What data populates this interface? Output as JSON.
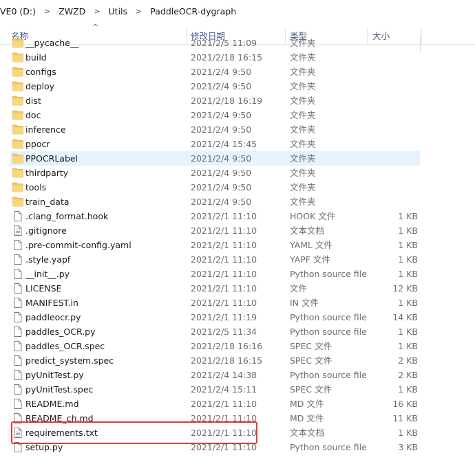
{
  "breadcrumb": [
    "VE0 (D:)",
    "ZWZD",
    "Utils",
    "PaddleOCR-dygraph"
  ],
  "columns": {
    "name": "名称",
    "date": "修改日期",
    "type": "类型",
    "size": "大小"
  },
  "colors": {
    "folder": "#f4c75e",
    "folder_dark": "#e0ac3a",
    "highlight": "#e5f3ff",
    "red_box": "#e33a3a",
    "header_text": "#4a5c86"
  },
  "files": [
    {
      "name": "__pycache__",
      "date": "2021/2/5 11:09",
      "type": "文件夹",
      "size": "",
      "icon": "folder-icon"
    },
    {
      "name": "build",
      "date": "2021/2/18 16:15",
      "type": "文件夹",
      "size": "",
      "icon": "folder-icon"
    },
    {
      "name": "configs",
      "date": "2021/2/4 9:50",
      "type": "文件夹",
      "size": "",
      "icon": "folder-icon"
    },
    {
      "name": "deploy",
      "date": "2021/2/4 9:50",
      "type": "文件夹",
      "size": "",
      "icon": "folder-icon"
    },
    {
      "name": "dist",
      "date": "2021/2/18 16:19",
      "type": "文件夹",
      "size": "",
      "icon": "folder-icon"
    },
    {
      "name": "doc",
      "date": "2021/2/4 9:50",
      "type": "文件夹",
      "size": "",
      "icon": "folder-icon"
    },
    {
      "name": "inference",
      "date": "2021/2/4 9:50",
      "type": "文件夹",
      "size": "",
      "icon": "folder-icon"
    },
    {
      "name": "ppocr",
      "date": "2021/2/4 15:45",
      "type": "文件夹",
      "size": "",
      "icon": "folder-icon"
    },
    {
      "name": "PPOCRLabel",
      "date": "2021/2/4 9:50",
      "type": "文件夹",
      "size": "",
      "icon": "folder-icon",
      "highlight": true
    },
    {
      "name": "thirdparty",
      "date": "2021/2/4 9:50",
      "type": "文件夹",
      "size": "",
      "icon": "folder-icon"
    },
    {
      "name": "tools",
      "date": "2021/2/4 9:50",
      "type": "文件夹",
      "size": "",
      "icon": "folder-icon"
    },
    {
      "name": "train_data",
      "date": "2021/2/4 9:50",
      "type": "文件夹",
      "size": "",
      "icon": "folder-icon"
    },
    {
      "name": ".clang_format.hook",
      "date": "2021/2/1 11:10",
      "type": "HOOK 文件",
      "size": "1 KB",
      "icon": "file-icon"
    },
    {
      "name": ".gitignore",
      "date": "2021/2/1 11:10",
      "type": "文本文档",
      "size": "1 KB",
      "icon": "text-file-icon"
    },
    {
      "name": ".pre-commit-config.yaml",
      "date": "2021/2/1 11:10",
      "type": "YAML 文件",
      "size": "1 KB",
      "icon": "file-icon"
    },
    {
      "name": ".style.yapf",
      "date": "2021/2/1 11:10",
      "type": "YAPF 文件",
      "size": "1 KB",
      "icon": "file-icon"
    },
    {
      "name": "__init__.py",
      "date": "2021/2/1 11:10",
      "type": "Python source file",
      "size": "1 KB",
      "icon": "file-icon"
    },
    {
      "name": "LICENSE",
      "date": "2021/2/1 11:10",
      "type": "文件",
      "size": "12 KB",
      "icon": "file-icon"
    },
    {
      "name": "MANIFEST.in",
      "date": "2021/2/1 11:10",
      "type": "IN 文件",
      "size": "1 KB",
      "icon": "file-icon"
    },
    {
      "name": "paddleocr.py",
      "date": "2021/2/1 11:19",
      "type": "Python source file",
      "size": "14 KB",
      "icon": "file-icon"
    },
    {
      "name": "paddles_OCR.py",
      "date": "2021/2/5 11:34",
      "type": "Python source file",
      "size": "1 KB",
      "icon": "file-icon"
    },
    {
      "name": "paddles_OCR.spec",
      "date": "2021/2/18 16:16",
      "type": "SPEC 文件",
      "size": "1 KB",
      "icon": "file-icon"
    },
    {
      "name": "predict_system.spec",
      "date": "2021/2/18 16:15",
      "type": "SPEC 文件",
      "size": "2 KB",
      "icon": "file-icon"
    },
    {
      "name": "pyUnitTest.py",
      "date": "2021/2/4 14:38",
      "type": "Python source file",
      "size": "2 KB",
      "icon": "file-icon"
    },
    {
      "name": "pyUnitTest.spec",
      "date": "2021/2/4 15:11",
      "type": "SPEC 文件",
      "size": "1 KB",
      "icon": "file-icon"
    },
    {
      "name": "README.md",
      "date": "2021/2/1 11:10",
      "type": "MD 文件",
      "size": "16 KB",
      "icon": "file-icon"
    },
    {
      "name": "README_ch.md",
      "date": "2021/2/1 11:10",
      "type": "MD 文件",
      "size": "11 KB",
      "icon": "file-icon"
    },
    {
      "name": "requirements.txt",
      "date": "2021/2/1 11:10",
      "type": "文本文档",
      "size": "1 KB",
      "icon": "text-file-icon"
    },
    {
      "name": "setup.py",
      "date": "2021/2/1 11:10",
      "type": "Python source file",
      "size": "3 KB",
      "icon": "file-icon"
    }
  ]
}
